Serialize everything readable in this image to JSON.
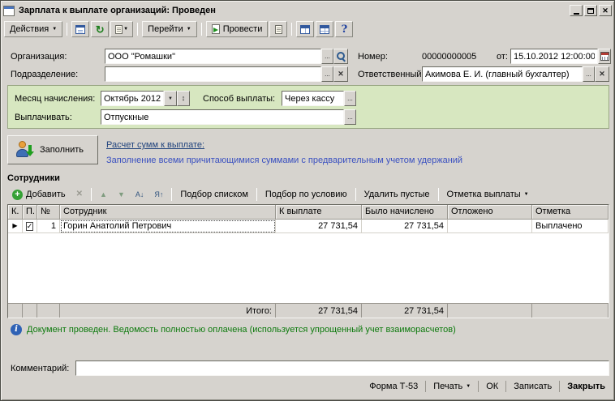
{
  "window": {
    "title": "Зарплата к выплате организаций: Проведен"
  },
  "toolbar": {
    "actions": "Действия",
    "goto": "Перейти",
    "post": "Провести"
  },
  "fields": {
    "org_label": "Организация:",
    "org_value": "ООО \"Ромашки\"",
    "dept_label": "Подразделение:",
    "dept_value": "",
    "number_label": "Номер:",
    "number_value": "00000000005",
    "date_label": "от:",
    "date_value": "15.10.2012 12:00:00",
    "responsible_label": "Ответственный:",
    "responsible_value": "Акимова Е. И. (главный бухгалтер)",
    "month_label": "Месяц начисления:",
    "month_value": "Октябрь 2012",
    "method_label": "Способ выплаты:",
    "method_value": "Через кассу",
    "pay_label": "Выплачивать:",
    "pay_value": "Отпускные"
  },
  "fill": {
    "button": "Заполнить",
    "link": "Расчет сумм к выплате:",
    "hint": "Заполнение всеми причитающимися суммами с предварительным учетом удержаний"
  },
  "employees": {
    "title": "Сотрудники",
    "toolbar": {
      "add": "Добавить",
      "pick_list": "Подбор списком",
      "pick_cond": "Подбор по условию",
      "remove_empty": "Удалить пустые",
      "pay_mark": "Отметка выплаты"
    },
    "columns": [
      "К.",
      "П.",
      "№",
      "Сотрудник",
      "К выплате",
      "Было начислено",
      "Отложено",
      "Отметка"
    ],
    "rows": [
      {
        "num": "1",
        "name": "Горин Анатолий Петрович",
        "to_pay": "27 731,54",
        "accrued": "27 731,54",
        "deferred": "",
        "mark": "Выплачено"
      }
    ],
    "totals": {
      "label": "Итого:",
      "to_pay": "27 731,54",
      "accrued": "27 731,54"
    }
  },
  "status": {
    "message": "Документ проведен. Ведомость полностью оплачена (используется упрощенный учет взаиморасчетов)"
  },
  "comment": {
    "label": "Комментарий:",
    "value": ""
  },
  "footer": {
    "t53": "Форма Т-53",
    "print": "Печать",
    "ok": "ОК",
    "save": "Записать",
    "close": "Закрыть"
  },
  "glyphs": {
    "dropdown": "▼",
    "ellipsis": "...",
    "clear": "✕",
    "refresh": "↻",
    "help": "?",
    "info": "i",
    "check": "✓",
    "marker": "▶",
    "plus": "+",
    "delete": "✕",
    "up": "▲",
    "down": "▼",
    "sort_az": "А↓",
    "sort_za": "Я↑",
    "spin": "↕",
    "close_win": "✕"
  }
}
